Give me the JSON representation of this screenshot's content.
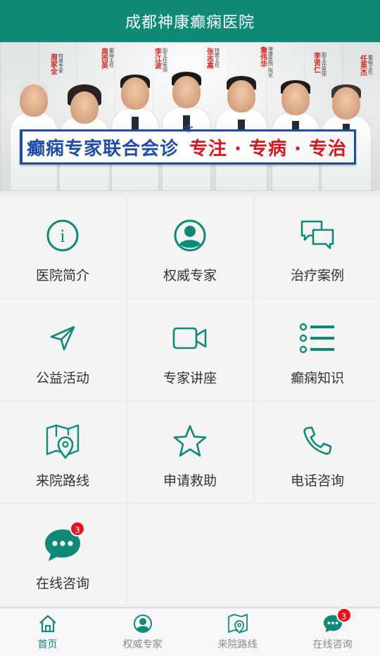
{
  "header": {
    "title": "成都神康癫痫医院"
  },
  "banner": {
    "slogan_left": "癫痫专家联合会诊",
    "slogan_right": "专注 · 专病 · 专治",
    "doctors": [
      {
        "name": "周家全",
        "title": "特邀专家"
      },
      {
        "name": "周而英",
        "title": "癫痫主任"
      },
      {
        "name": "李江波",
        "title": "副主任医师"
      },
      {
        "name": "张志高",
        "title": "特聘主任"
      },
      {
        "name": "詹伟华",
        "title": "神康医院 院长"
      },
      {
        "name": "李贤仁",
        "title": "副主任医师"
      },
      {
        "name": "任英杰",
        "title": "癫痫主任"
      }
    ],
    "slide_count": 5,
    "active_slide": 5
  },
  "menu": [
    {
      "label": "医院简介",
      "icon": "info-icon"
    },
    {
      "label": "权威专家",
      "icon": "person-icon"
    },
    {
      "label": "治疗案例",
      "icon": "chat-bubbles-icon"
    },
    {
      "label": "公益活动",
      "icon": "send-icon"
    },
    {
      "label": "专家讲座",
      "icon": "video-camera-icon"
    },
    {
      "label": "癫痫知识",
      "icon": "list-icon"
    },
    {
      "label": "来院路线",
      "icon": "map-pin-icon"
    },
    {
      "label": "申请救助",
      "icon": "star-icon"
    },
    {
      "label": "电话咨询",
      "icon": "phone-icon"
    },
    {
      "label": "在线咨询",
      "icon": "chat-icon",
      "badge": "3"
    }
  ],
  "tabbar": {
    "items": [
      {
        "label": "首页",
        "icon": "home-icon",
        "active": true
      },
      {
        "label": "权威专家",
        "icon": "person-icon"
      },
      {
        "label": "来院路线",
        "icon": "map-icon"
      },
      {
        "label": "在线咨询",
        "icon": "chat-icon",
        "badge": "3"
      }
    ]
  },
  "colors": {
    "brand": "#0f8a77",
    "badge": "#e8121a",
    "slogan_blue": "#1f4da6",
    "slogan_red": "#d4181d"
  }
}
